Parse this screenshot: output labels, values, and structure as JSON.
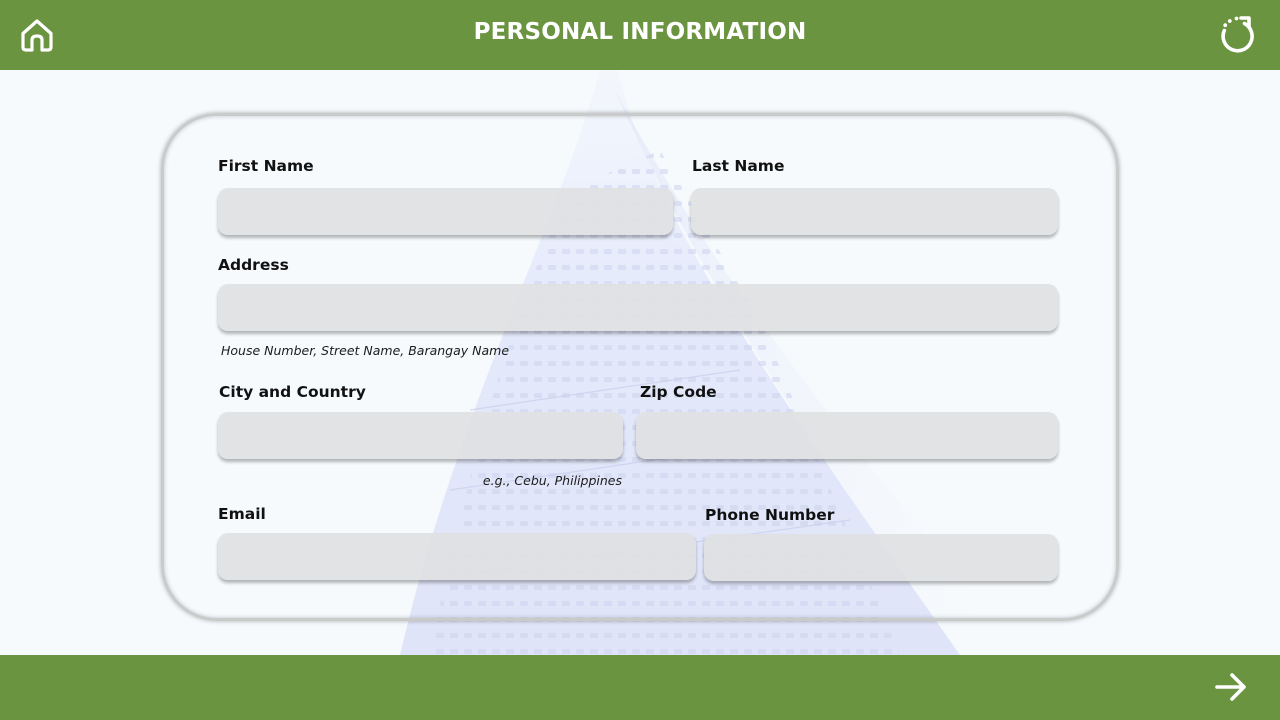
{
  "header": {
    "title": "PERSONAL INFORMATION",
    "home_icon": "home-icon",
    "reset_icon": "refresh-icon"
  },
  "form": {
    "first_name": {
      "label": "First Name",
      "value": ""
    },
    "last_name": {
      "label": "Last Name",
      "value": ""
    },
    "address": {
      "label": "Address",
      "value": "",
      "hint": "House Number, Street Name, Barangay Name"
    },
    "city_country": {
      "label": "City and Country",
      "value": "",
      "hint": "e.g., Cebu, Philippines"
    },
    "zip_code": {
      "label": "Zip Code",
      "value": ""
    },
    "email": {
      "label": "Email",
      "value": ""
    },
    "phone": {
      "label": "Phone Number",
      "value": ""
    }
  },
  "footer": {
    "next_icon": "arrow-right-icon"
  },
  "colors": {
    "bar": "#6b9440",
    "background": "#f6fafd",
    "field": "#dfe1e3"
  }
}
